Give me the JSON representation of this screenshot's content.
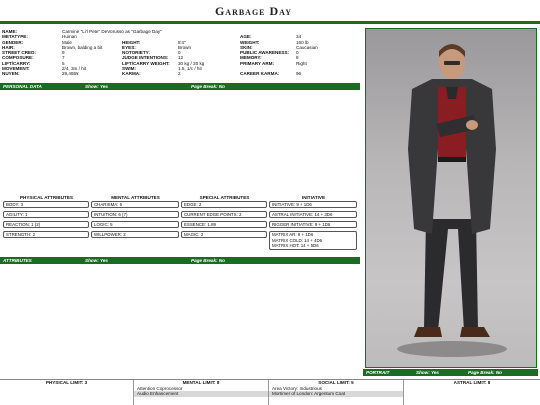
{
  "page": {
    "title": "Garbage Day"
  },
  "personal": {
    "name_label": "NAME:",
    "name": "Carmine \"Li'l Pete\" DeVorusso as \"Garbage Day\"",
    "metatype_label": "METATYPE:",
    "metatype": "Human",
    "age_label": "AGE:",
    "age": "34",
    "gender_label": "GENDER:",
    "gender": "Male",
    "height_label": "HEIGHT:",
    "height": "5'4\"",
    "weight_label": "WEIGHT:",
    "weight": "160 lb",
    "hair_label": "HAIR:",
    "hair": "Brown, balding a bit",
    "eyes_label": "EYES:",
    "eyes": "Brown",
    "skin_label": "SKIN:",
    "skin": "Caucasian",
    "street_cred_label": "STREET CRED:",
    "street_cred": "9",
    "notoriety_label": "NOTORIETY:",
    "notoriety": "0",
    "public_awareness_label": "PUBLIC AWARENESS:",
    "public_awareness": "0",
    "composure_label": "COMPOSURE:",
    "composure": "7",
    "judge_intentions_label": "JUDGE INTENTIONS:",
    "judge_intentions": "12",
    "memory_label": "MEMORY:",
    "memory": "8",
    "lift_carry_label": "LIFT/CARRY:",
    "lift_carry": "5",
    "lift_carry_weight_label": "LIFT/CARRY WEIGHT:",
    "lift_carry_weight": "30 kg / 20 kg",
    "primary_arm_label": "PRIMARY ARM:",
    "primary_arm": "Right",
    "movement_label": "MOVEMENT:",
    "movement": "2/4, 3m / hit",
    "swim_label": "SWIM:",
    "swim": "1.5, 1/c / hit",
    "nuyen_label": "NUYEN:",
    "nuyen": "29,486¥",
    "karma_label": "KARMA:",
    "karma": "2",
    "career_karma_label": "CAREER KARMA:",
    "career_karma": "96"
  },
  "bars": {
    "personal": {
      "label": "PERSONAL DATA",
      "show": "Show: Yes",
      "break": "Page Break: No"
    },
    "attributes": {
      "label": "ATTRIBUTES",
      "show": "Show: Yes",
      "break": "Page Break: No"
    },
    "portrait": {
      "label": "PORTRAIT",
      "show": "Show: Yes",
      "break": "Page Break: No"
    }
  },
  "attributes": {
    "headers": [
      "PHYSICAL ATTRIBUTES",
      "MENTAL ATTRIBUTES",
      "SPECIAL ATTRIBUTES",
      "INITIATIVE"
    ],
    "rows": [
      [
        "BODY: 3",
        "CHARISMA: 5",
        "EDGE: 2",
        "INITIATIVE: 9 + 1D6"
      ],
      [
        "AGILITY: 1",
        "INTUITION: 6 (7)",
        "CURRENT EDGE POINTS: 2",
        "ASTRAL INITIATIVE: 14 + 3D6"
      ],
      [
        "REACTION: 1 (2)",
        "LOGIC: 5",
        "ESSENCE: 1.89",
        "RIGGER INITIATIVE: 9 + 1D6"
      ]
    ],
    "last_row": [
      "STRENGTH: 2",
      "WILLPOWER: 2",
      "MAGIC: 2"
    ],
    "matrix": [
      "MATRIX AR: 9 + 1D6",
      "MATRIX COLD: 14 + 4D6",
      "MATRIX HOT: 14 + 5D6"
    ]
  },
  "limits": {
    "physical": "PHYSICAL LIMIT: 3",
    "mental": "MENTAL LIMIT: 8",
    "mental_items": [
      "Attention Coprocessor",
      "Audio Enhancement"
    ],
    "social": "SOCIAL LIMIT: 5",
    "social_items": [
      "Area Victory: Industrious",
      "Mortimer of London: Argentum Coat"
    ],
    "astral": "ASTRAL LIMIT: 8"
  },
  "colors": {
    "accent": "#1c6b24"
  }
}
